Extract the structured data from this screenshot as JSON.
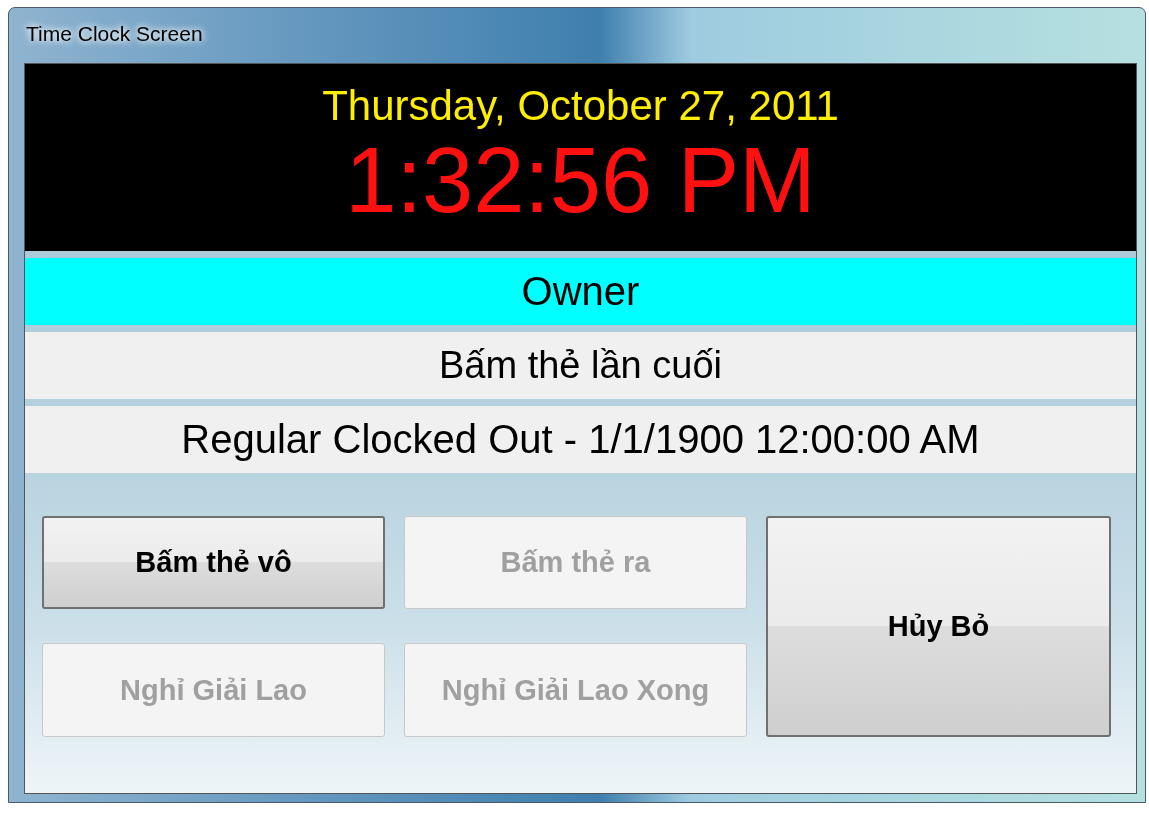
{
  "window": {
    "title": "Time Clock Screen"
  },
  "clock": {
    "date": "Thursday, October 27, 2011",
    "time": "1:32:56 PM"
  },
  "employee": {
    "name": "Owner"
  },
  "last_punch": {
    "label": "Bấm thẻ lần cuối",
    "value": "Regular Clocked Out - 1/1/1900 12:00:00 AM"
  },
  "buttons": [
    {
      "label": "Bấm thẻ vô",
      "disabled": false,
      "kind": "small"
    },
    {
      "label": "Bấm thẻ ra",
      "disabled": true,
      "kind": "small"
    },
    {
      "label": "Hủy Bỏ",
      "disabled": false,
      "kind": "tall"
    },
    {
      "label": "Nghỉ Giải Lao",
      "disabled": true,
      "kind": "small"
    },
    {
      "label": "Nghỉ Giải Lao Xong",
      "disabled": true,
      "kind": "small"
    }
  ]
}
